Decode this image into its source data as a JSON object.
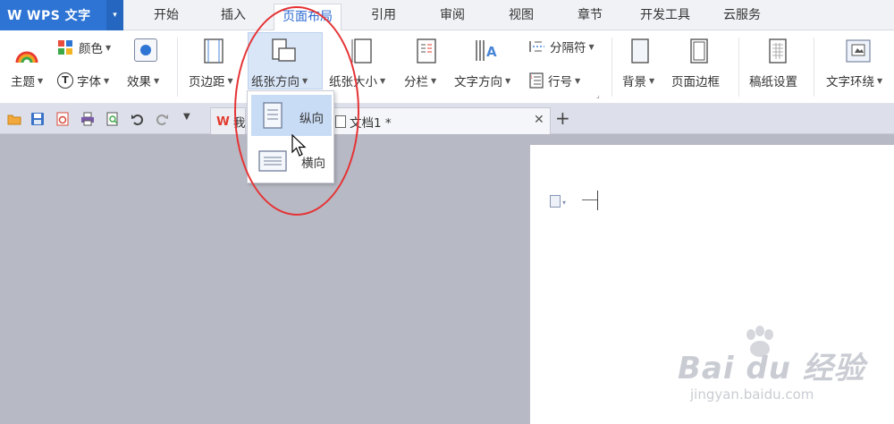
{
  "app": {
    "name": "WPS 文字"
  },
  "menu": {
    "tabs": [
      {
        "label": "开始"
      },
      {
        "label": "插入"
      },
      {
        "label": "页面布局"
      },
      {
        "label": "引用"
      },
      {
        "label": "审阅"
      },
      {
        "label": "视图"
      },
      {
        "label": "章节"
      },
      {
        "label": "开发工具"
      },
      {
        "label": "云服务"
      }
    ],
    "active": "页面布局"
  },
  "ribbon": {
    "color": "颜色",
    "theme": "主题",
    "font": "字体",
    "effect": "效果",
    "margins": "页边距",
    "orientation": "纸张方向",
    "size": "纸张大小",
    "columns": "分栏",
    "text_direction": "文字方向",
    "breaks": "分隔符",
    "line_numbers": "行号",
    "background": "背景",
    "page_border": "页面边框",
    "manuscript": "稿纸设置",
    "wrap": "文字环绕"
  },
  "tabs": {
    "home_tab_label": "我",
    "document_tab_label": "文档1 *"
  },
  "dropdown": {
    "portrait": "纵向",
    "landscape": "横向"
  },
  "watermark": {
    "brand": "Bai du 经验",
    "url": "jingyan.baidu.com"
  },
  "colors": {
    "accent": "#2e74d4",
    "annotation": "#e53335",
    "hover": "#c9dcf6"
  }
}
